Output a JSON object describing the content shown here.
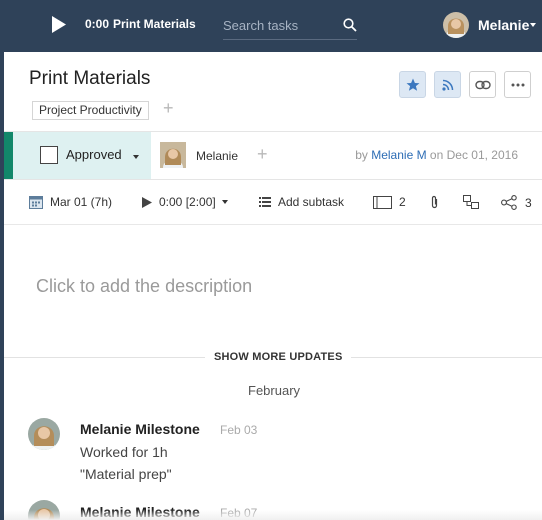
{
  "topbar": {
    "timer": "0:00",
    "task_name": "Print Materials",
    "search_placeholder": "Search tasks",
    "user_name": "Melanie"
  },
  "task": {
    "title": "Print Materials",
    "project_tag": "Project Productivity",
    "status": "Approved",
    "assignee": "Melanie",
    "created_by_prefix": "by",
    "created_by": "Melanie M",
    "created_on": "on Dec 01, 2016"
  },
  "meta": {
    "date": "Mar 01 (7h)",
    "time": "0:00 [2:00]",
    "add_subtask": "Add subtask",
    "notes_count": "2",
    "share_count": "3"
  },
  "description_placeholder": "Click to add the description",
  "updates": {
    "show_more_label": "SHOW MORE UPDATES",
    "month": "February",
    "items": [
      {
        "author": "Melanie Milestone",
        "date": "Feb 03",
        "line1": "Worked for 1h",
        "line2": "\"Material prep\""
      },
      {
        "author": "Melanie Milestone",
        "date": "Feb 07"
      }
    ]
  },
  "colors": {
    "topbar": "#2f4259",
    "status_stripe": "#12876a",
    "status_bg": "#def1f1",
    "link": "#2d6db5",
    "star": "#3c78bf"
  },
  "icons": [
    "play-icon",
    "search-icon",
    "star-icon",
    "rss-icon",
    "link-icon",
    "more-icon",
    "calendar-icon",
    "play-small-icon",
    "subtask-list-icon",
    "notes-icon",
    "paperclip-icon",
    "dependency-icon",
    "share-icon"
  ]
}
